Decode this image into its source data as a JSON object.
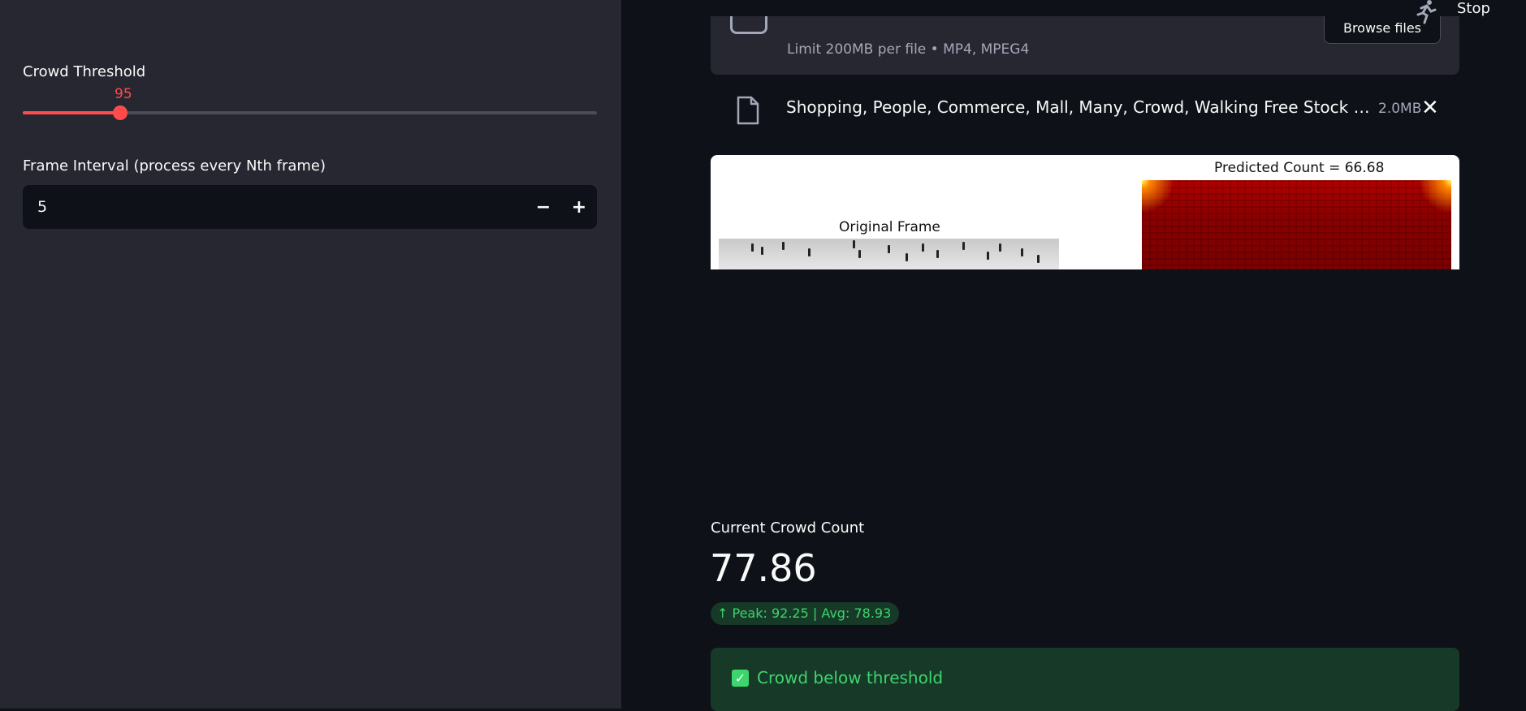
{
  "sidebar": {
    "threshold": {
      "label": "Crowd Threshold",
      "value": "95",
      "fraction": 0.17
    },
    "interval": {
      "label": "Frame Interval (process every Nth frame)",
      "value": "5",
      "minus": "−",
      "plus": "+"
    }
  },
  "header": {
    "stop_label": "Stop",
    "more_label": "⋮"
  },
  "uploader": {
    "limit_text": "Limit 200MB per file • MP4, MPEG4",
    "browse_label": "Browse files"
  },
  "file": {
    "name": "Shopping, People, Commerce, Mall, Many, Crowd, Walking Free Stock video footage",
    "size": "2.0MB",
    "close": "✕"
  },
  "figure": {
    "original_title": "Original Frame",
    "predicted_title": "Predicted Count = 66.68"
  },
  "metric": {
    "label": "Current Crowd Count",
    "value": "77.86",
    "delta": "↑ Peak: 92.25 | Avg: 78.93"
  },
  "alert": {
    "text": "Crowd below threshold",
    "icon": "✓"
  },
  "colors": {
    "accent": "#ff4b4b",
    "success": "#3dd56d",
    "success_bg": "#173928",
    "sidebar_bg": "#262730",
    "main_bg": "#0e1117"
  }
}
